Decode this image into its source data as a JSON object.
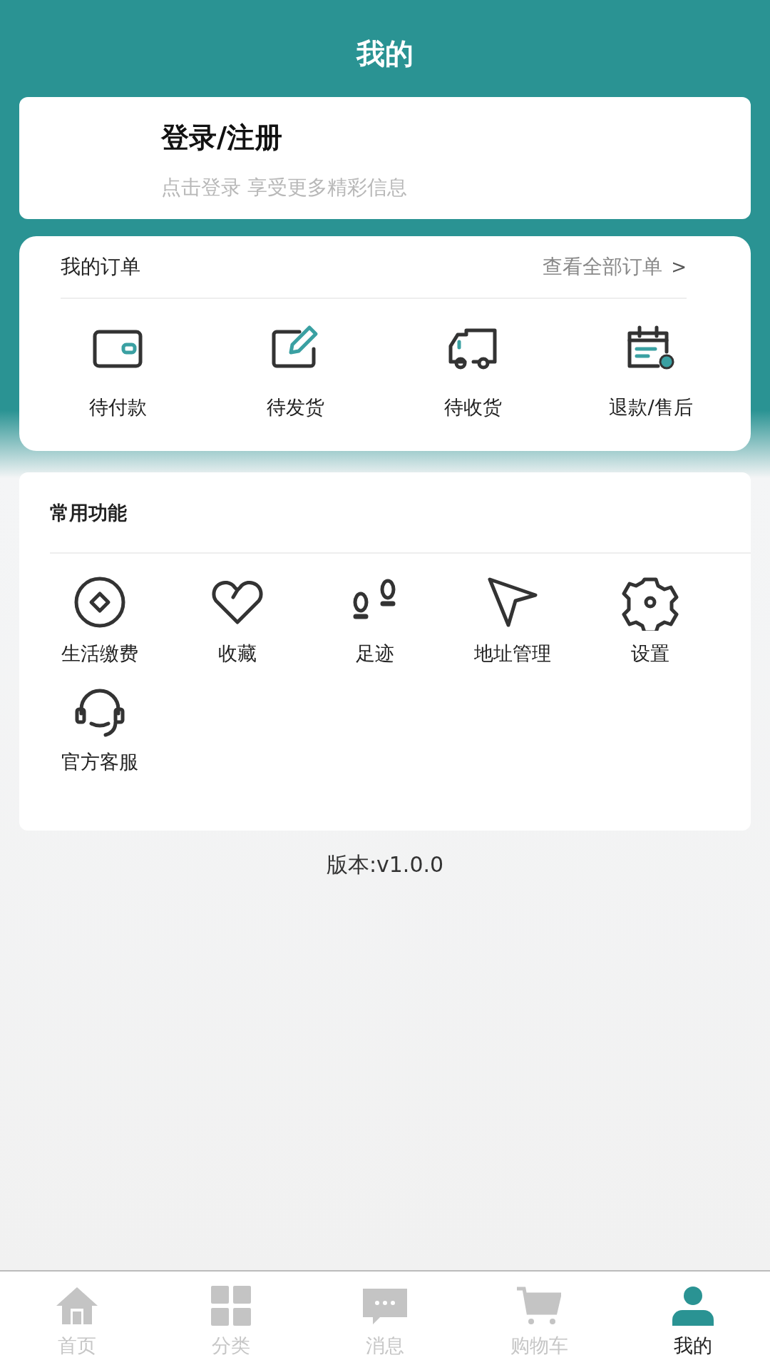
{
  "header": {
    "title": "我的"
  },
  "login": {
    "title": "登录/注册",
    "subtitle": "点击登录 享受更多精彩信息"
  },
  "orders": {
    "title": "我的订单",
    "view_all": "查看全部订单",
    "chevron": ">",
    "items": [
      {
        "kind": "wallet",
        "label": "待付款"
      },
      {
        "kind": "edit",
        "label": "待发货"
      },
      {
        "kind": "truck",
        "label": "待收货"
      },
      {
        "kind": "calendar",
        "label": "退款/售后"
      }
    ]
  },
  "functions": {
    "title": "常用功能",
    "items": [
      {
        "kind": "coin",
        "label": "生活缴费"
      },
      {
        "kind": "heart",
        "label": "收藏"
      },
      {
        "kind": "footprints",
        "label": "足迹"
      },
      {
        "kind": "pointer",
        "label": "地址管理"
      },
      {
        "kind": "gear",
        "label": "设置"
      },
      {
        "kind": "headset",
        "label": "官方客服"
      }
    ]
  },
  "version": "版本:v1.0.0",
  "tabbar": [
    {
      "kind": "home",
      "label": "首页",
      "selected": false
    },
    {
      "kind": "grid",
      "label": "分类",
      "selected": false
    },
    {
      "kind": "message",
      "label": "消息",
      "selected": false
    },
    {
      "kind": "cart",
      "label": "购物车",
      "selected": false
    },
    {
      "kind": "user",
      "label": "我的",
      "selected": true
    }
  ]
}
